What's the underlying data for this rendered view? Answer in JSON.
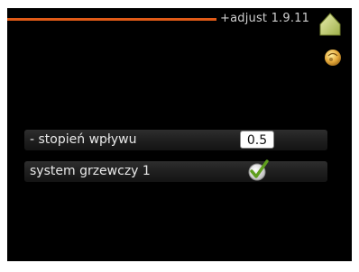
{
  "header": {
    "title": "+adjust 1.9.11",
    "accent_color": "#e05a17",
    "home_icon": "home-icon",
    "sun_icon": "sun-icon"
  },
  "settings": [
    {
      "label": "- stopień wpływu",
      "value": "0.5",
      "control": "value-box"
    },
    {
      "label": "system grzewczy 1",
      "checked": true,
      "control": "checkbox",
      "icon": "checkmark-icon"
    }
  ]
}
